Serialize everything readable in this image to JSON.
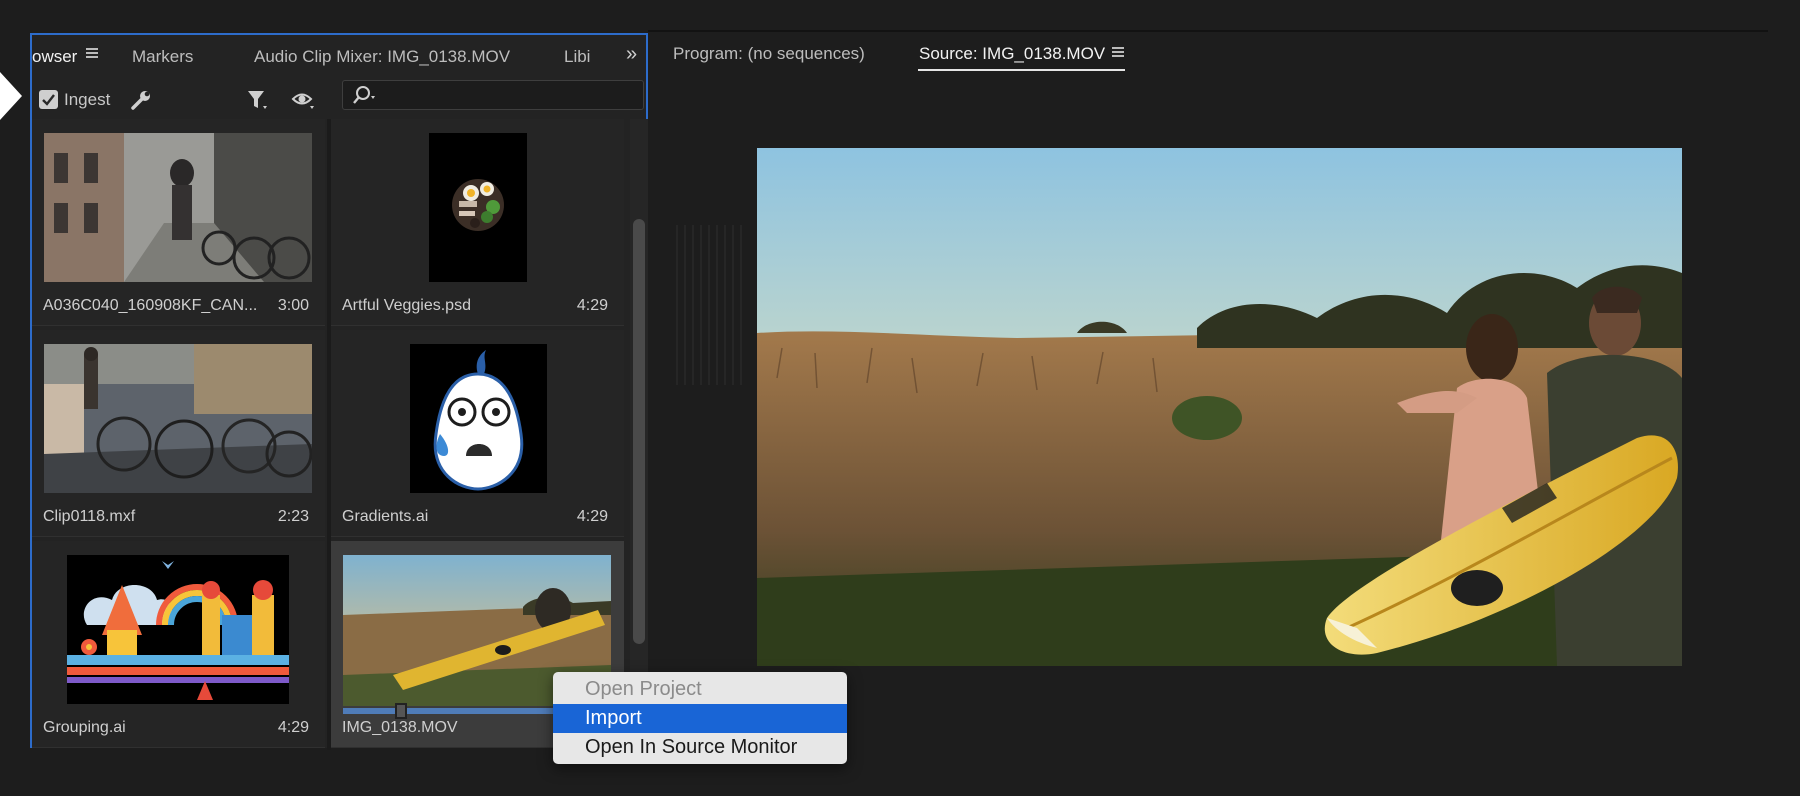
{
  "browser": {
    "tabs": [
      "owser",
      "Markers",
      "Audio Clip Mixer: IMG_0138.MOV",
      "Libi"
    ],
    "overflow_label": "»",
    "ingest_label": "Ingest",
    "ingest_checked": true,
    "search_value": ""
  },
  "items": [
    {
      "name": "A036C040_160908KF_CAN...",
      "duration": "3:00"
    },
    {
      "name": "Artful Veggies.psd",
      "duration": "4:29"
    },
    {
      "name": "Clip0118.mxf",
      "duration": "2:23"
    },
    {
      "name": "Gradients.ai",
      "duration": "4:29"
    },
    {
      "name": "Grouping.ai",
      "duration": "4:29"
    },
    {
      "name": "IMG_0138.MOV",
      "duration": ""
    }
  ],
  "monitor": {
    "program_tab": "Program: (no sequences)",
    "source_tab": "Source: IMG_0138.MOV"
  },
  "context_menu": {
    "items": [
      "Open Project",
      "Import",
      "Open In Source Monitor"
    ],
    "disabled_index": 0,
    "highlighted_index": 1
  },
  "colors": {
    "accent_border": "#2d6ccb",
    "menu_highlight": "#1965d6",
    "background": "#1d1d1d"
  }
}
